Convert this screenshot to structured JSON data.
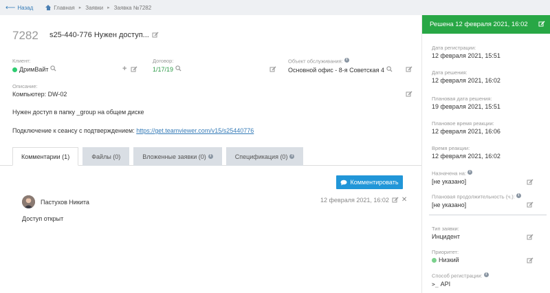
{
  "nav": {
    "back": "Назад",
    "home": "Главная",
    "requests": "Заявки",
    "current": "Заявка №7282"
  },
  "ticket": {
    "number": "7282",
    "title": "s25-440-776 Нужен доступ..."
  },
  "client": {
    "label": "Клиент:",
    "value": "ДримВайт"
  },
  "contract": {
    "label": "Договор:",
    "value": "1/17/19"
  },
  "object": {
    "label": "Объект обслуживания:",
    "value": "Основной офис - 8-я Советская 4"
  },
  "description": {
    "label": "Описание:",
    "line1": "Компьютер: DW-02",
    "line2": "Нужен доступ в папку _group на общем диске",
    "line3_prefix": "Подключение к сеансу с подтверждением: ",
    "line3_link": "https://get.teamviewer.com/v15/s25440776"
  },
  "tabs": [
    {
      "label": "Комментарии (1)"
    },
    {
      "label": "Файлы (0)"
    },
    {
      "label": "Вложенные заявки (0)"
    },
    {
      "label": "Спецификация (0)"
    }
  ],
  "comment_button": "Комментировать",
  "comment": {
    "author": "Пастухов Никита",
    "time": "12 февраля 2021, 16:02",
    "text": "Доступ открыт"
  },
  "side": {
    "status": "Решена 12 февраля 2021, 16:02",
    "reg_date": {
      "label": "Дата регистрации:",
      "value": "12 февраля 2021, 15:51"
    },
    "solve_date": {
      "label": "Дата решения:",
      "value": "12 февраля 2021, 16:02"
    },
    "plan_solve": {
      "label": "Плановая дата решения:",
      "value": "19 февраля 2021, 15:51"
    },
    "plan_react": {
      "label": "Плановое время реакции:",
      "value": "12 февраля 2021, 16:06"
    },
    "react_time": {
      "label": "Время реакции:",
      "value": "12 февраля 2021, 16:02"
    },
    "assigned": {
      "label": "Назначена на:",
      "value": "[не указано]"
    },
    "plan_duration": {
      "label": "Плановая продолжительность (ч.):",
      "value": "[не указано]"
    },
    "type": {
      "label": "Тип заявки:",
      "value": "Инцидент"
    },
    "priority": {
      "label": "Приоритет:",
      "value": "Низкий"
    },
    "reg_method": {
      "label": "Способ регистрации:",
      "value": "API"
    }
  },
  "colors": {
    "accent": "#2196d8",
    "status": "#28a745",
    "link": "#337ab7"
  }
}
